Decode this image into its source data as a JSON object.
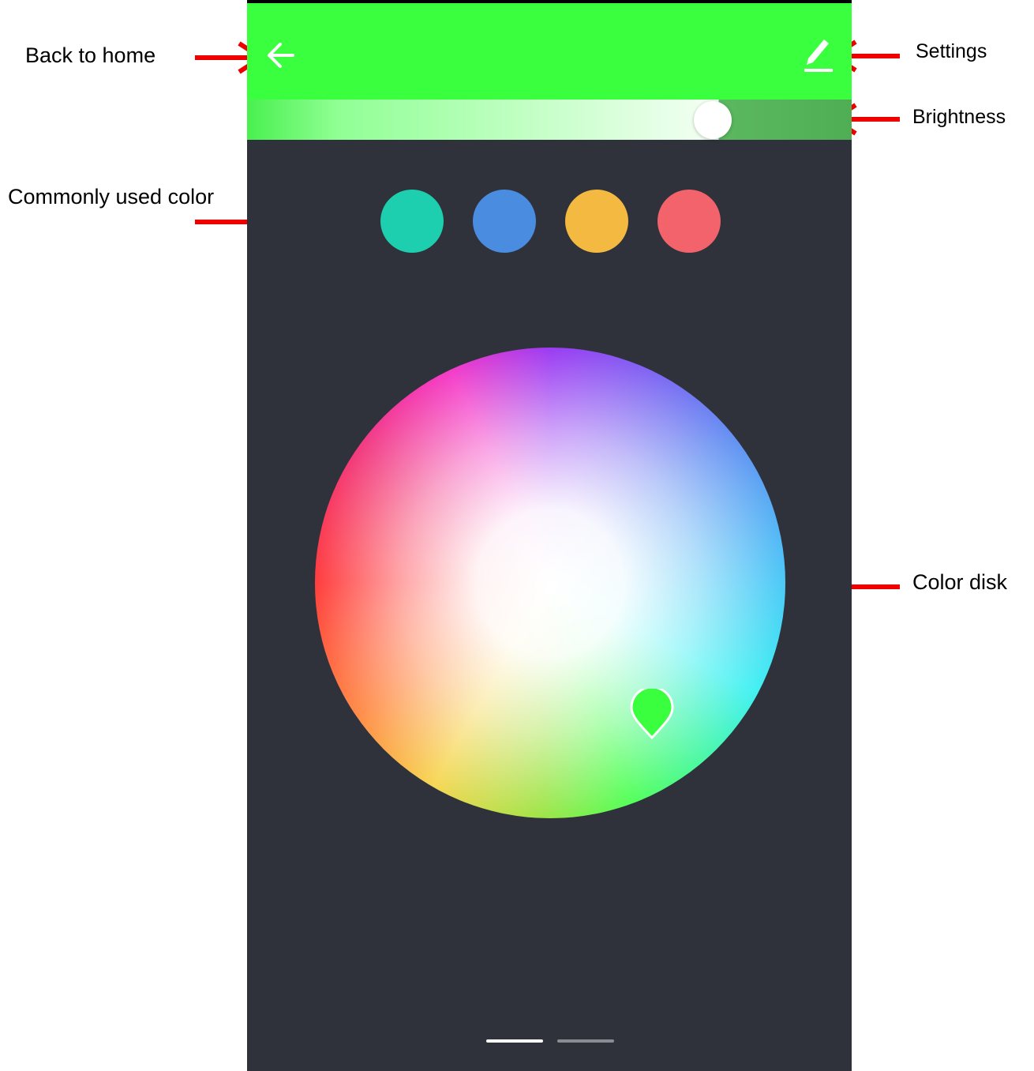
{
  "annotations": {
    "back": "Back to home",
    "settings": "Settings",
    "brightness": "Brightness",
    "common_color": "Commonly used color",
    "color_disk": "Color disk"
  },
  "header": {
    "background": "#39ff3e",
    "back_icon": "arrow-left-icon",
    "settings_icon": "pencil-edit-icon"
  },
  "brightness": {
    "level": 0.77
  },
  "swatches": [
    {
      "color": "#1dcfae"
    },
    {
      "color": "#4a8de0"
    },
    {
      "color": "#f4b940"
    },
    {
      "color": "#f2636b"
    }
  ],
  "color_wheel": {
    "selected_color": "#39ff3e",
    "picker_icon": "map-pin-icon"
  },
  "pager": {
    "current": 1,
    "total": 2
  },
  "colors": {
    "annotation_arrow": "#ee0000",
    "app_background": "#2f323b"
  }
}
